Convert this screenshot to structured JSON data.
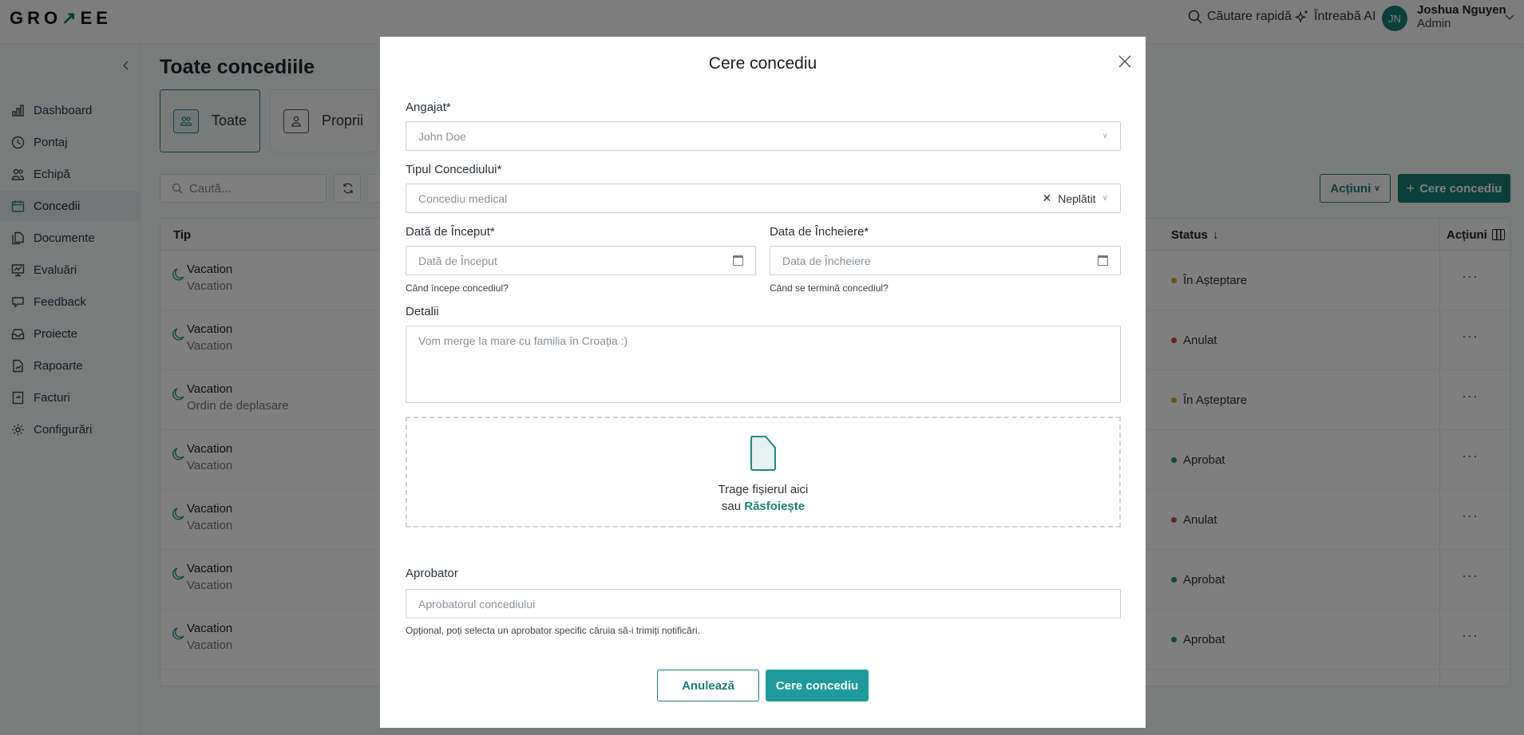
{
  "header": {
    "logo": "GROWEE",
    "quick_search": "Căutare rapidă",
    "ask_ai": "Întreabă AI",
    "user": {
      "initials": "JN",
      "name": "Joshua Nguyen",
      "role": "Admin"
    }
  },
  "sidebar": {
    "items": [
      {
        "label": "Dashboard",
        "icon": "bar-chart-icon"
      },
      {
        "label": "Pontaj",
        "icon": "clock-icon"
      },
      {
        "label": "Echipă",
        "icon": "users-icon"
      },
      {
        "label": "Concedii",
        "icon": "calendar-icon",
        "active": true
      },
      {
        "label": "Documente",
        "icon": "documents-icon"
      },
      {
        "label": "Evaluări",
        "icon": "presentation-icon"
      },
      {
        "label": "Feedback",
        "icon": "chat-icon"
      },
      {
        "label": "Proiecte",
        "icon": "inbox-icon"
      },
      {
        "label": "Rapoarte",
        "icon": "report-icon"
      },
      {
        "label": "Facturi",
        "icon": "invoice-icon"
      },
      {
        "label": "Configurări",
        "icon": "gear-icon"
      }
    ]
  },
  "main": {
    "title": "Toate concediile",
    "tabs": [
      {
        "label": "Toate",
        "active": true
      },
      {
        "label": "Proprii"
      }
    ],
    "search_placeholder": "Caută...",
    "actions_label": "Acțiuni",
    "request_label": "Cere concediu",
    "columns": {
      "type": "Tip",
      "status": "Status",
      "actions": "Acțiuni"
    },
    "rows": [
      {
        "type": "Vacation",
        "subtype": "Vacation",
        "status": "În Așteptare",
        "color": "#d4a017"
      },
      {
        "type": "Vacation",
        "subtype": "Vacation",
        "status": "Anulat",
        "color": "#d64545"
      },
      {
        "type": "Vacation",
        "subtype": "Ordin de deplasare",
        "status": "În Așteptare",
        "color": "#d4a017"
      },
      {
        "type": "Vacation",
        "subtype": "Vacation",
        "status": "Aprobat",
        "color": "#1f9d55"
      },
      {
        "type": "Vacation",
        "subtype": "Vacation",
        "status": "Anulat",
        "color": "#d64545"
      },
      {
        "type": "Vacation",
        "subtype": "Vacation",
        "status": "Aprobat",
        "color": "#1f9d55"
      },
      {
        "type": "Vacation",
        "subtype": "Vacation",
        "status": "Aprobat",
        "color": "#1f9d55"
      }
    ]
  },
  "modal": {
    "title": "Cere concediu",
    "employee": {
      "label": "Angajat*",
      "value": "John Doe"
    },
    "leave_type": {
      "label": "Tipul Concediului*",
      "value": "Concediu medical",
      "tag": "Neplătit"
    },
    "start": {
      "label": "Dată de Început*",
      "placeholder": "Dată de Început",
      "help": "Când începe concediul?"
    },
    "end": {
      "label": "Data de Încheiere*",
      "placeholder": "Data de Încheiere",
      "help": "Când se termină concediul?"
    },
    "details": {
      "label": "Detalii",
      "placeholder": "Vom merge la mare cu familia în Croația :)"
    },
    "upload": {
      "text": "Trage fișierul aici",
      "or": "sau",
      "browse": "Răsfoiește"
    },
    "approver": {
      "label": "Aprobator",
      "placeholder": "Aprobatorul concediului",
      "help": "Opțional, poți selecta un aprobator specific căruia să-i trimiți notificări."
    },
    "cancel": "Anulează",
    "submit": "Cere concediu"
  },
  "colors": {
    "accent": "#187d77",
    "button": "#1e9a9a"
  }
}
